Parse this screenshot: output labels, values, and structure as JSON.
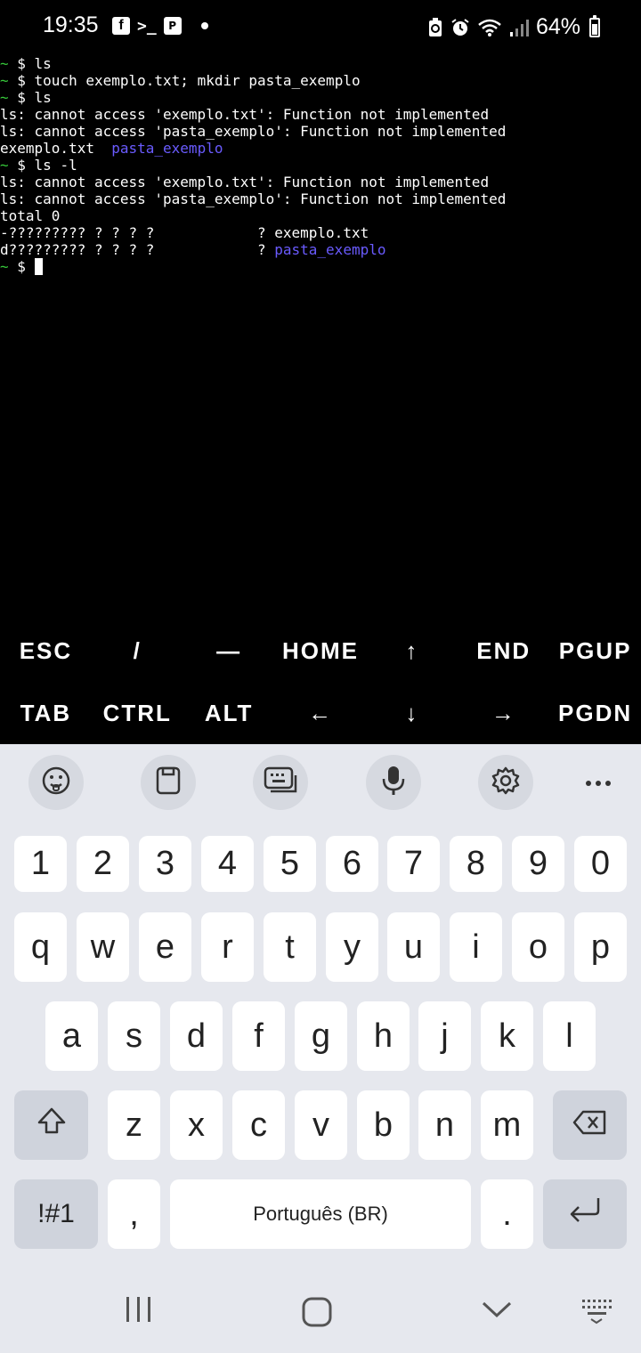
{
  "status_bar": {
    "time": "19:35",
    "left_icons": [
      "facebook-icon",
      "terminal-icon",
      "p-app-icon",
      "dot-icon"
    ],
    "right_icons": [
      "battery-saver-icon",
      "alarm-icon",
      "wifi-icon",
      "signal-icon"
    ],
    "battery_percent": "64%"
  },
  "terminal": {
    "lines": [
      {
        "tilde": "~",
        "rest": " $ ls"
      },
      {
        "tilde": "~",
        "rest": " $ touch exemplo.txt; mkdir pasta_exemplo"
      },
      {
        "tilde": "~",
        "rest": " $ ls"
      },
      {
        "text": "ls: cannot access 'exemplo.txt': Function not implemented"
      },
      {
        "text": "ls: cannot access 'pasta_exemplo': Function not implemented"
      },
      {
        "text": "exemplo.txt  ",
        "dir": "pasta_exemplo"
      },
      {
        "tilde": "~",
        "rest": " $ ls -l"
      },
      {
        "text": "ls: cannot access 'exemplo.txt': Function not implemented"
      },
      {
        "text": "ls: cannot access 'pasta_exemplo': Function not implemented"
      },
      {
        "text": "total 0"
      },
      {
        "text": "-????????? ? ? ? ?            ? exemplo.txt"
      },
      {
        "text": "d????????? ? ? ? ?            ? ",
        "dir": "pasta_exemplo"
      },
      {
        "tilde": "~",
        "rest": " $ ",
        "cursor": true
      }
    ],
    "colors": {
      "tilde": "#36c93a",
      "dir": "#6a5bff",
      "text": "#ffffff"
    }
  },
  "extra_keys": {
    "row1": [
      "ESC",
      "/",
      "—",
      "HOME",
      "↑",
      "END",
      "PGUP"
    ],
    "row2": [
      "TAB",
      "CTRL",
      "ALT",
      "←",
      "↓",
      "→",
      "PGDN"
    ]
  },
  "keyboard": {
    "toolbar": [
      "emoji-icon",
      "clipboard-icon",
      "keyboard-icon",
      "microphone-icon",
      "settings-icon",
      "more-icon"
    ],
    "numbers": [
      "1",
      "2",
      "3",
      "4",
      "5",
      "6",
      "7",
      "8",
      "9",
      "0"
    ],
    "row_q": [
      "q",
      "w",
      "e",
      "r",
      "t",
      "y",
      "u",
      "i",
      "o",
      "p"
    ],
    "row_a": [
      "a",
      "s",
      "d",
      "f",
      "g",
      "h",
      "j",
      "k",
      "l"
    ],
    "row_z": [
      "z",
      "x",
      "c",
      "v",
      "b",
      "n",
      "m"
    ],
    "symbols_label": "!#1",
    "comma": ",",
    "space_label": "Português (BR)",
    "period": "."
  },
  "nav_bar": {
    "buttons": [
      "recents-icon",
      "home-icon",
      "back-icon",
      "keyboard-switch-icon"
    ]
  }
}
